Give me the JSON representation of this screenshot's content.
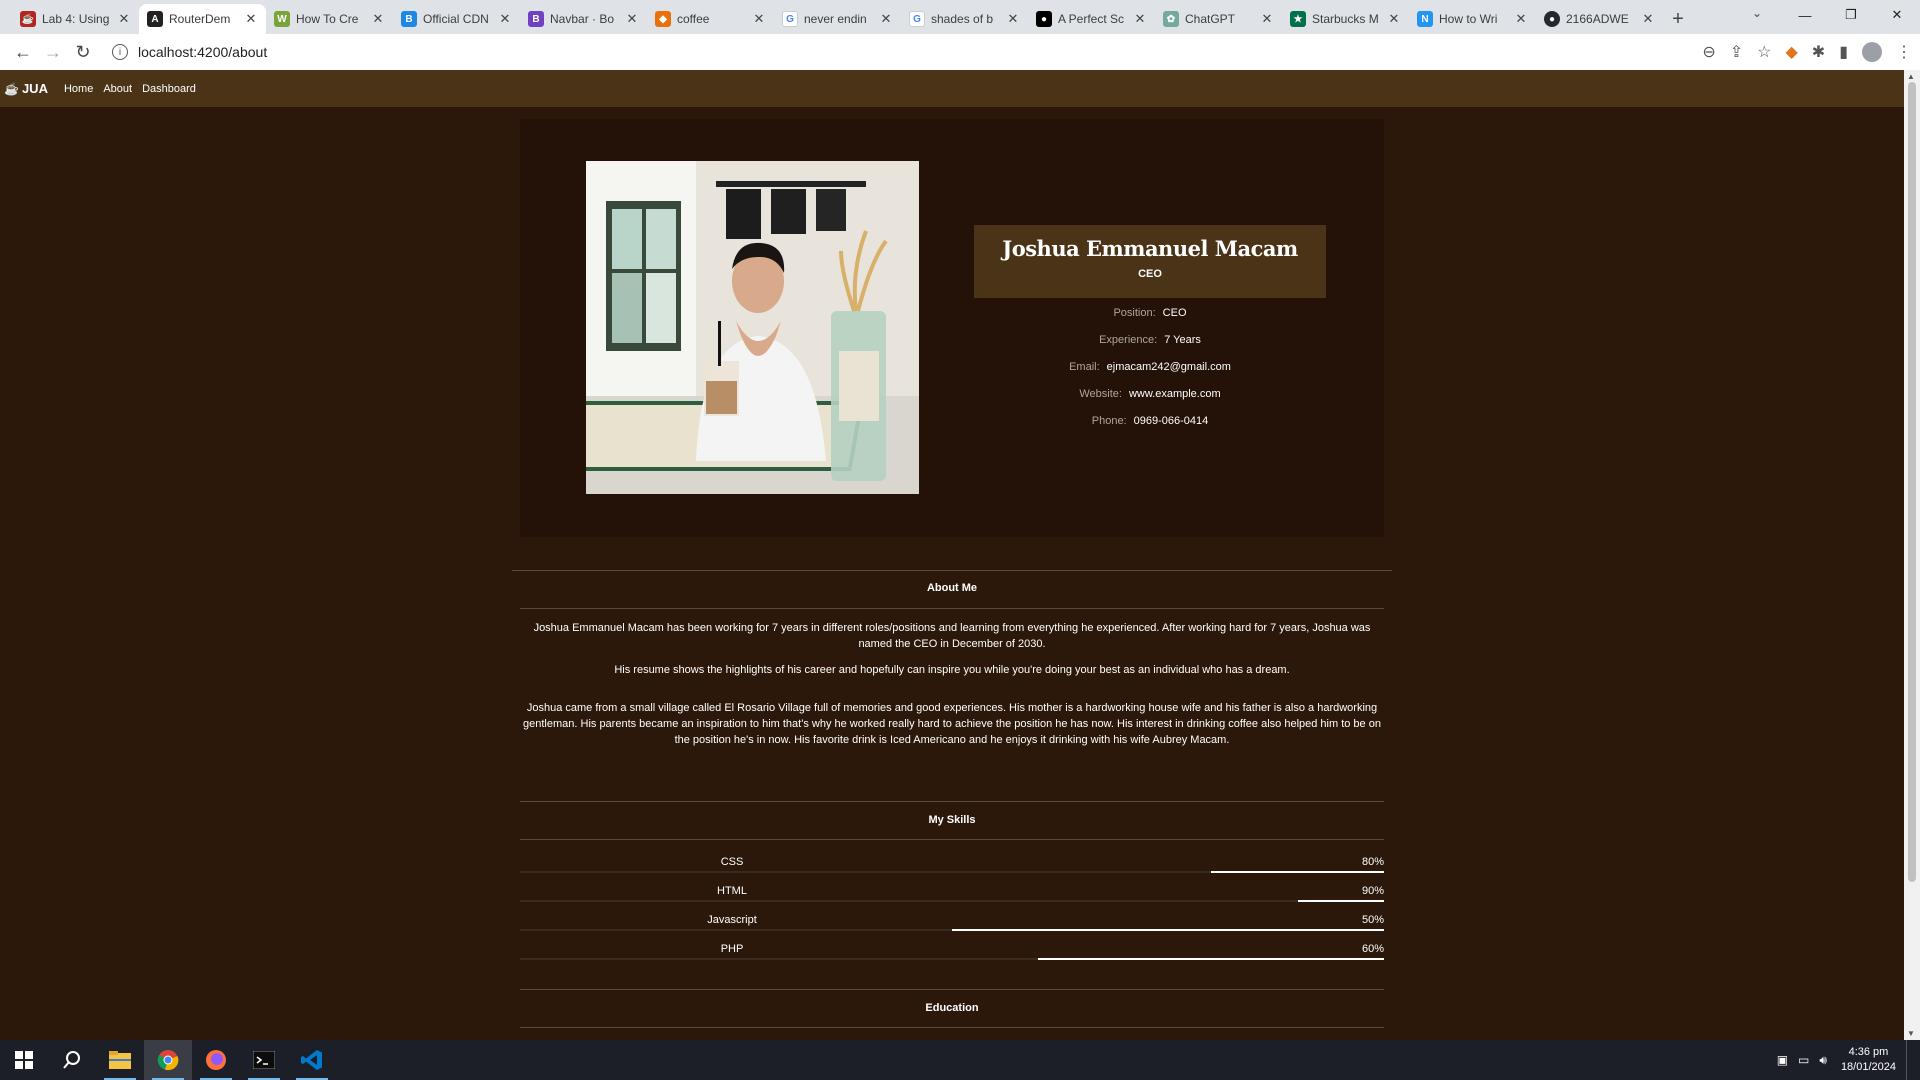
{
  "browser": {
    "tabs": [
      {
        "title": "Lab 4: Using",
        "icon": "cup-icon",
        "color": "#b3261e"
      },
      {
        "title": "RouterDem",
        "icon": "angular-icon",
        "color": "#222222",
        "active": true
      },
      {
        "title": "How To Cre",
        "icon": "wikihow-icon",
        "color": "#7aa43a"
      },
      {
        "title": "Official CDN",
        "icon": "bootstrap-b-icon",
        "color": "#1e88e5"
      },
      {
        "title": "Navbar · Bo",
        "icon": "bootstrap-icon",
        "color": "#6f42c1"
      },
      {
        "title": "coffee",
        "icon": "shield-icon",
        "color": "#e8710a"
      },
      {
        "title": "never endin",
        "icon": "google-icon",
        "color": "#4285f4"
      },
      {
        "title": "shades of b",
        "icon": "google-icon",
        "color": "#4285f4"
      },
      {
        "title": "A Perfect Sc",
        "icon": "medium-icon",
        "color": "#000000"
      },
      {
        "title": "ChatGPT",
        "icon": "chatgpt-icon",
        "color": "#74aa9c"
      },
      {
        "title": "Starbucks M",
        "icon": "starbucks-icon",
        "color": "#00704a"
      },
      {
        "title": "How to Wri",
        "icon": "n-icon",
        "color": "#2196f3"
      },
      {
        "title": "2166ADWE",
        "icon": "github-icon",
        "color": "#24292f"
      }
    ],
    "url": "localhost:4200/about"
  },
  "app": {
    "brand": "JUA",
    "nav": [
      "Home",
      "About",
      "Dashboard"
    ]
  },
  "profile": {
    "name": "Joshua Emmanuel Macam",
    "role": "CEO",
    "details": [
      {
        "label": "Position:",
        "value": "CEO"
      },
      {
        "label": "Experience:",
        "value": "7 Years"
      },
      {
        "label": "Email:",
        "value": "ejmacam242@gmail.com"
      },
      {
        "label": "Website:",
        "value": "www.example.com"
      },
      {
        "label": "Phone:",
        "value": "0969-066-0414"
      }
    ]
  },
  "about": {
    "title": "About Me",
    "paragraphs": [
      "Joshua Emmanuel Macam has been working for 7 years in different roles/positions and learning from everything he experienced. After working hard for 7 years, Joshua was named the CEO in December of 2030.",
      "His resume shows the highlights of his career and hopefully can inspire you while you're doing your best as an individual who has a dream.",
      "Joshua came from a small village called El Rosario Village full of memories and good experiences. His mother is a hardworking house wife and his father is also a hardworking gentleman. His parents became an inspiration to him that's why he worked really hard to achieve the position he has now. His interest in drinking coffee also helped him to be on the position he's in now. His favorite drink is Iced Americano and he enjoys it drinking with his wife Aubrey Macam."
    ]
  },
  "skills": {
    "title": "My Skills",
    "items": [
      {
        "name": "CSS",
        "label": "80%",
        "level": 0.2
      },
      {
        "name": "HTML",
        "label": "90%",
        "level": 0.1
      },
      {
        "name": "Javascript",
        "label": "50%",
        "level": 0.5
      },
      {
        "name": "PHP",
        "label": "60%",
        "level": 0.4
      }
    ]
  },
  "education": {
    "title": "Education"
  },
  "taskbar": {
    "time": "4:36 pm",
    "date": "18/01/2024"
  }
}
